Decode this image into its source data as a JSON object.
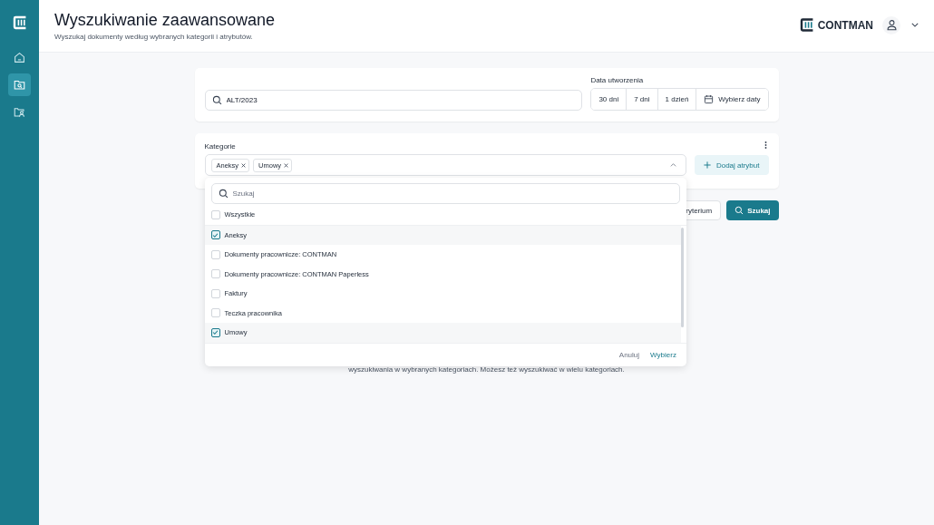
{
  "header": {
    "title": "Wyszukiwanie zaawansowane",
    "subtitle": "Wyszukaj dokumenty według wybranych kategorii i atrybutów.",
    "brand": "CONTMAN"
  },
  "sidebar": {
    "items": [
      {
        "kind": "home",
        "selected": false
      },
      {
        "kind": "search-folder",
        "selected": true
      },
      {
        "kind": "people-folder",
        "selected": false
      }
    ]
  },
  "search": {
    "value": "ALT/2023"
  },
  "date_filter": {
    "label": "Data utworzenia",
    "options": [
      {
        "label": "30 dni",
        "selected": false
      },
      {
        "label": "7 dni",
        "selected": false
      },
      {
        "label": "1 dzień",
        "selected": false
      }
    ],
    "custom": "Wybierz daty"
  },
  "categories": {
    "label": "Kategorie",
    "tags": [
      "Aneksy",
      "Umowy"
    ],
    "expanded": true,
    "add_attribute": "Dodaj atrybut"
  },
  "dropdown": {
    "search_placeholder": "Szukaj",
    "all": {
      "label": "Wszystkie",
      "checked": false
    },
    "items": [
      {
        "label": "Aneksy",
        "checked": true
      },
      {
        "label": "Dokumenty pracownicze: CONTMAN",
        "checked": false
      },
      {
        "label": "Dokumenty pracownicze: CONTMAN Paperless",
        "checked": false
      },
      {
        "label": "Faktury",
        "checked": false
      },
      {
        "label": "Teczka pracownika",
        "checked": false
      },
      {
        "label": "Umowy",
        "checked": true
      }
    ],
    "cancel": "Anuluj",
    "confirm": "Wybierz"
  },
  "actions": {
    "add_criterion": "ryterium",
    "search": "Szukaj"
  },
  "hint": "wyszukiwania w wybranych kategoriach. Możesz też wyszukiwać w wielu kategoriach."
}
